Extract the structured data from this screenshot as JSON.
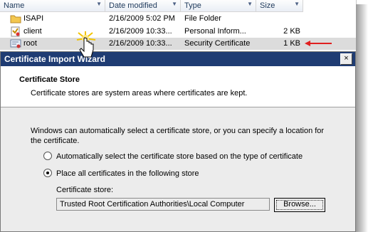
{
  "explorer": {
    "columns": [
      "Name",
      "Date modified",
      "Type",
      "Size"
    ],
    "rows": [
      {
        "name": "ISAPI",
        "date": "2/16/2009 5:02 PM",
        "type": "File Folder",
        "size": "",
        "icon": "folder-icon"
      },
      {
        "name": "client",
        "date": "2/16/2009 10:33...",
        "type": "Personal Inform...",
        "size": "2 KB",
        "icon": "personal-cert-icon"
      },
      {
        "name": "root",
        "date": "2/16/2009 10:33...",
        "type": "Security Certificate",
        "size": "1 KB",
        "icon": "certificate-icon"
      }
    ],
    "pointer_color": "#e02020"
  },
  "dialog": {
    "title": "Certificate Import Wizard",
    "close_glyph": "×",
    "section_title": "Certificate Store",
    "section_desc": "Certificate stores are system areas where certificates are kept.",
    "intro": "Windows can automatically select a certificate store, or you can specify a location for the certificate.",
    "option_auto": "Automatically select the certificate store based on the type of certificate",
    "option_place": "Place all certificates in the following store",
    "store_label": "Certificate store:",
    "store_value": "Trusted Root Certification Authorities\\Local Computer",
    "browse_label": "Browse..."
  },
  "colors": {
    "titlebar": "#1f3c73",
    "dialog_bg": "#ececec",
    "selected_row": "#dcdcdc"
  }
}
